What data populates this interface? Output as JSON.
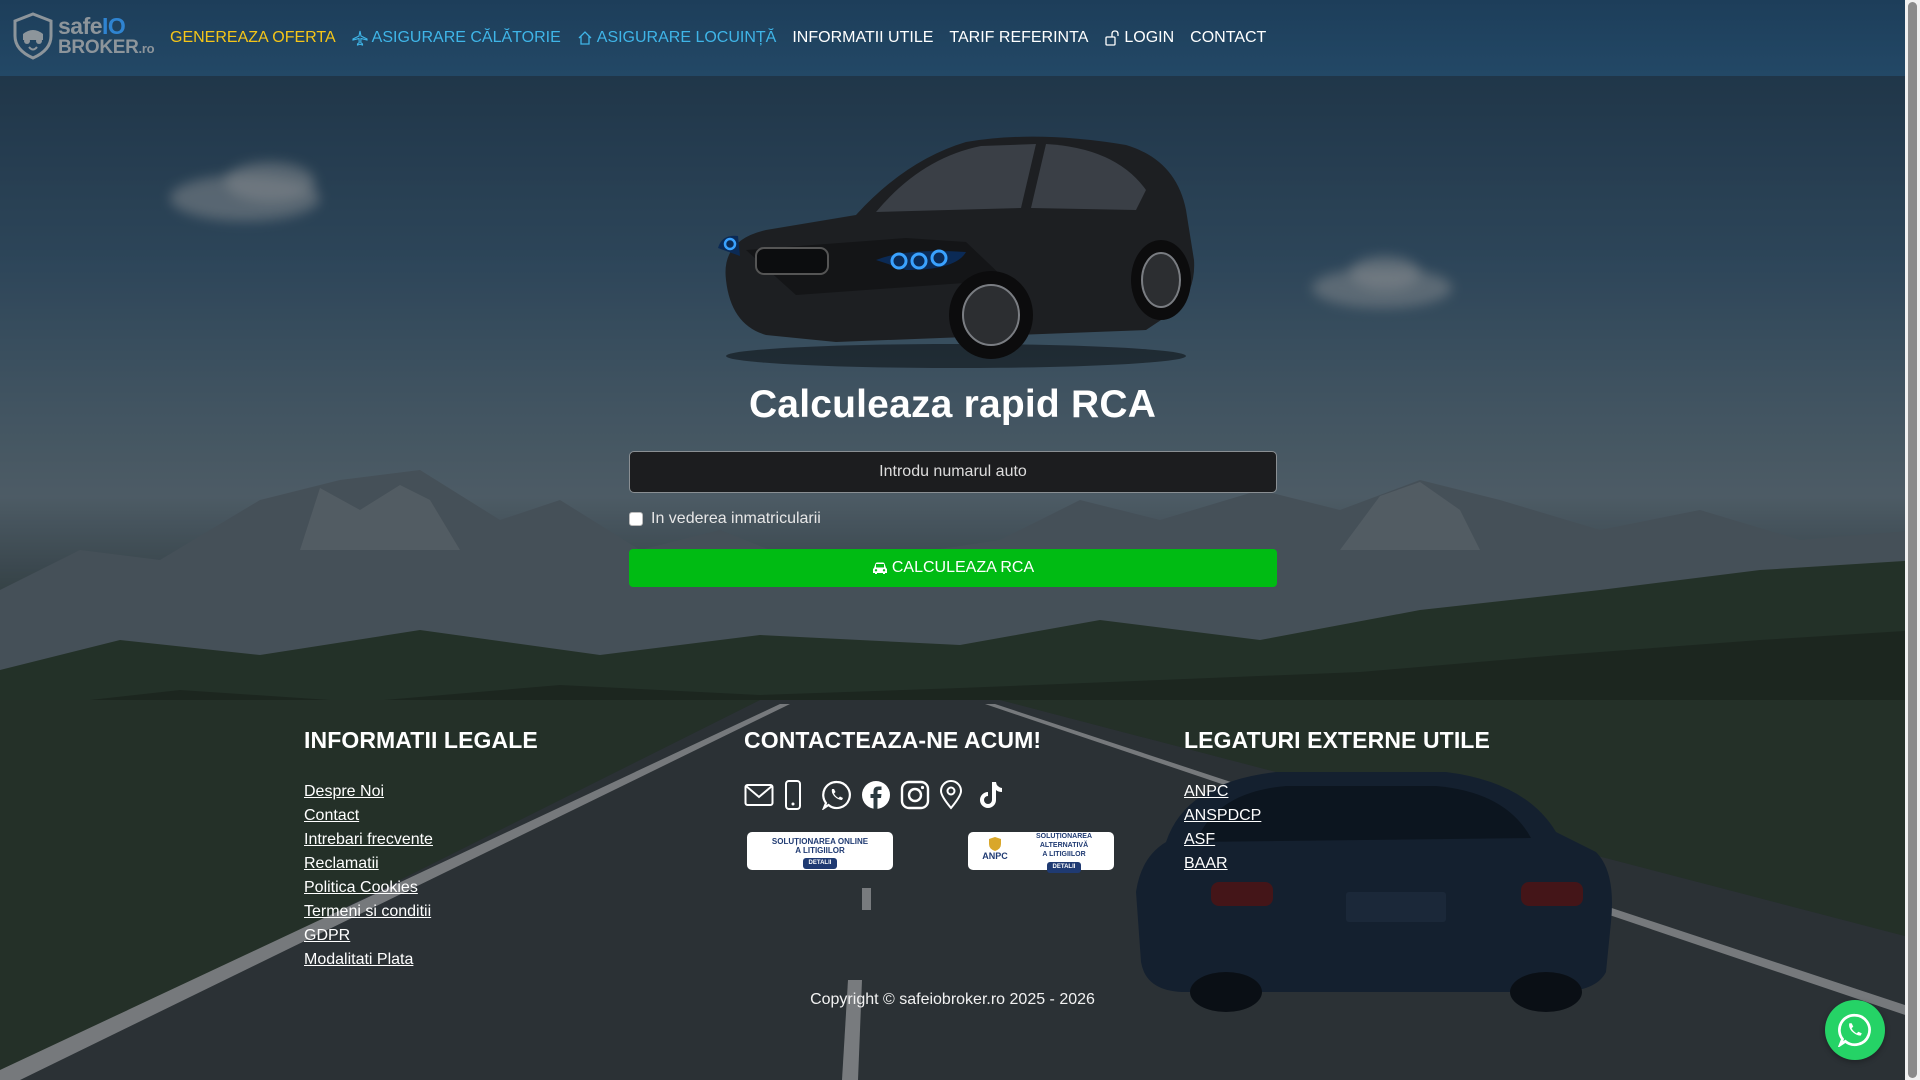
{
  "brand": {
    "name_part1": "safe",
    "name_part2": "IO",
    "name_part3": "BROKER",
    "name_suffix": ".ro"
  },
  "nav": {
    "items": [
      {
        "label": "GENEREAZA OFERTA",
        "color": "#f5c518",
        "icon": ""
      },
      {
        "label": "ASIGURARE CĂLĂTORIE",
        "color": "#3fb5e8",
        "icon": "plane-icon"
      },
      {
        "label": "ASIGURARE LOCUINȚĂ",
        "color": "#3fb5e8",
        "icon": "home-icon"
      },
      {
        "label": "INFORMATII UTILE",
        "color": "#ffffff",
        "icon": ""
      },
      {
        "label": "TARIF REFERINTA",
        "color": "#ffffff",
        "icon": ""
      },
      {
        "label": "LOGIN",
        "color": "#ffffff",
        "icon": "unlock-icon"
      },
      {
        "label": "CONTACT",
        "color": "#ffffff",
        "icon": ""
      }
    ]
  },
  "hero": {
    "title": "Calculeaza rapid RCA",
    "plate_placeholder": "Introdu numarul auto",
    "plate_value": "",
    "checkbox_label": "In vederea inmatricularii",
    "checkbox_checked": false,
    "button_label": "CALCULEAZA RCA",
    "button_color": "#00bb13"
  },
  "footer": {
    "legal": {
      "heading": "INFORMATII LEGALE",
      "links": [
        "Despre Noi",
        "Contact",
        "Intrebari frecvente",
        "Reclamatii",
        "Politica Cookies",
        "Termeni si conditii",
        "GDPR",
        "Modalitati Plata"
      ]
    },
    "contact": {
      "heading": "CONTACTEAZA-NE ACUM!",
      "icons": [
        "envelope-icon",
        "phone-icon",
        "whatsapp-icon",
        "facebook-icon",
        "instagram-icon",
        "location-pin-icon",
        "tiktok-icon"
      ],
      "badge_online": {
        "line1": "SOLUȚIONAREA ONLINE",
        "line2": "A LITIGIILOR",
        "detail": "DETALII"
      },
      "badge_alt": {
        "seal": "ANPC",
        "line1": "SOLUȚIONAREA ALTERNATIVĂ",
        "line2": "A LITIGIILOR",
        "detail": "DETALII"
      }
    },
    "external": {
      "heading": "LEGATURI EXTERNE UTILE",
      "links": [
        "ANPC",
        "ANSPDCP",
        "ASF",
        "BAAR"
      ]
    },
    "copyright": "Copyright © safeiobroker.ro 2025 - 2026"
  },
  "colors": {
    "navbar": "#234866",
    "accent_yellow": "#f5c518",
    "accent_blue": "#3fb5e8",
    "whatsapp": "#25d366"
  }
}
